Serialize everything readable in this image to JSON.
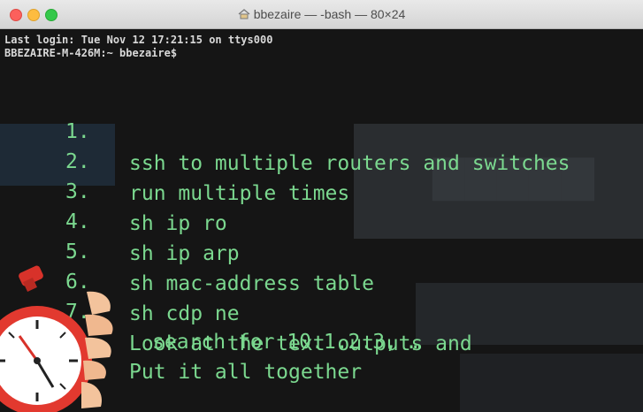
{
  "window": {
    "title": "bbezaire — -bash — 80×24"
  },
  "terminal": {
    "last_login": "Last login: Tue Nov 12 17:21:15 on ttys000",
    "prompt": "BBEZAIRE-M-426M:~ bbezaire$"
  },
  "steps": [
    {
      "num": "1.",
      "text": "ssh to multiple routers and switches"
    },
    {
      "num": "2.",
      "text": "run multiple times"
    },
    {
      "num": "3.",
      "text": "sh ip ro"
    },
    {
      "num": "4.",
      "text": "sh ip arp"
    },
    {
      "num": "5.",
      "text": "sh mac-address table"
    },
    {
      "num": "6.",
      "text": "sh cdp ne"
    },
    {
      "num": "7.",
      "text": "Look at the text outputs and"
    }
  ],
  "step7_continuation": "search for 10.1.2.3, …",
  "step8_text": "Put it all together",
  "colors": {
    "terminal_text": "#7bd88f",
    "background": "#151515"
  },
  "icons": [
    "home-icon",
    "stopwatch-icon"
  ]
}
